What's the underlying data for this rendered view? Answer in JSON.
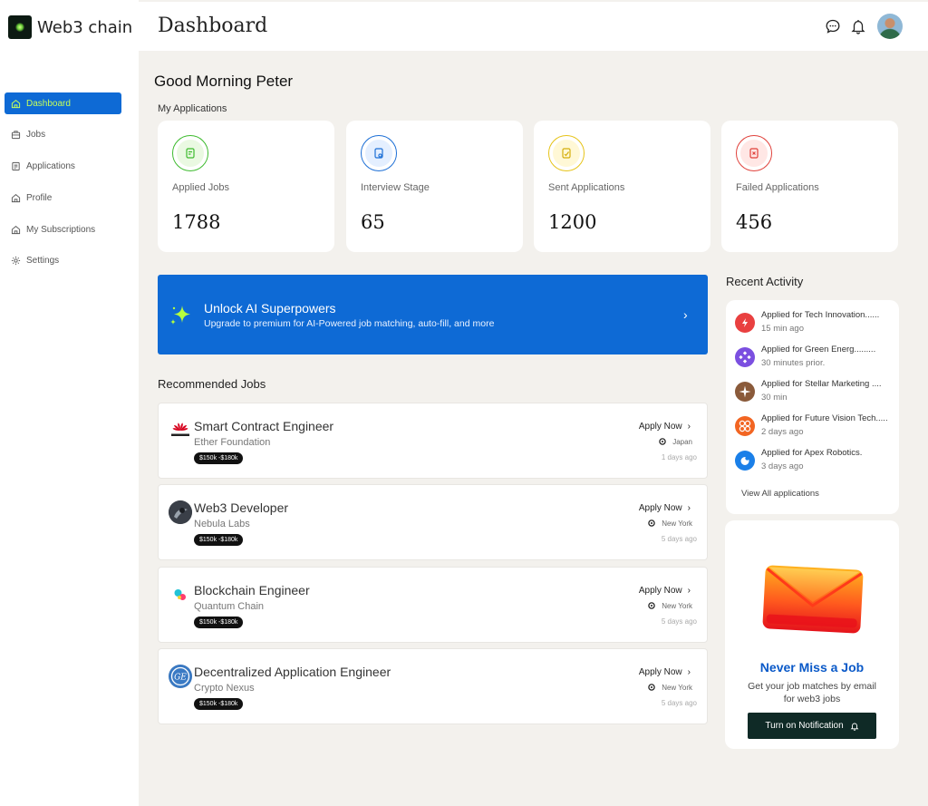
{
  "app": {
    "brand": "Web3 chain"
  },
  "sidebar": {
    "items": [
      {
        "label": "Dashboard",
        "icon": "home-icon",
        "active": true
      },
      {
        "label": "Jobs",
        "icon": "briefcase-icon"
      },
      {
        "label": "Applications",
        "icon": "document-icon"
      },
      {
        "label": "Profile",
        "icon": "home-icon"
      },
      {
        "label": "My Subscriptions",
        "icon": "home-icon"
      },
      {
        "label": "Settings",
        "icon": "gear-icon"
      }
    ]
  },
  "header": {
    "title": "Dashboard"
  },
  "greeting": "Good Morning Peter",
  "my_applications": {
    "label": "My Applications",
    "cards": [
      {
        "label": "Applied Jobs",
        "value": "1788",
        "color": "#3dbb2e"
      },
      {
        "label": "Interview Stage",
        "value": "65",
        "color": "#1c6fd6"
      },
      {
        "label": "Sent Applications",
        "value": "1200",
        "color": "#e6c317"
      },
      {
        "label": "Failed Applications",
        "value": "456",
        "color": "#e0403a"
      }
    ]
  },
  "banner": {
    "title": "Unlock AI Superpowers",
    "subtitle": "Upgrade to premium for AI-Powered job matching, auto-fill, and more"
  },
  "recommended": {
    "label": "Recommended Jobs",
    "apply_label": "Apply Now",
    "jobs": [
      {
        "title": "Smart Contract Engineer",
        "company": "Ether Foundation",
        "salary": "$150k -$180k",
        "location": "Japan",
        "posted": "1 days ago",
        "logo": "huawei-logo"
      },
      {
        "title": "Web3 Developer",
        "company": "Nebula Labs",
        "salary": "$150k -$180k",
        "location": "New York",
        "posted": "5 days ago",
        "logo": "nebula-logo"
      },
      {
        "title": "Blockchain Engineer",
        "company": "Quantum Chain",
        "salary": "$150k -$180k",
        "location": "New York",
        "posted": "5 days ago",
        "logo": "quantum-logo"
      },
      {
        "title": "Decentralized Application Engineer",
        "company": "Crypto Nexus",
        "salary": "$150k -$180k",
        "location": "New York",
        "posted": "5 days ago",
        "logo": "ge-logo"
      }
    ]
  },
  "recent_activity": {
    "label": "Recent Activity",
    "items": [
      {
        "title": "Applied for Tech Innovation......",
        "time": "15 min ago",
        "color": "#e94040"
      },
      {
        "title": "Applied for Green Energ.........",
        "time": "30 minutes prior.",
        "color": "#7b4fe0"
      },
      {
        "title": "Applied for Stellar Marketing ....",
        "time": "30 min",
        "color": "#8a5a3a"
      },
      {
        "title": "Applied for Future Vision Tech.....",
        "time": "2 days ago",
        "color": "#f26522"
      },
      {
        "title": "Applied for Apex Robotics.",
        "time": "3 days ago",
        "color": "#1a7fe8"
      }
    ],
    "view_all": "View All applications"
  },
  "notification": {
    "title": "Never Miss a Job",
    "subtitle": "Get your job matches by email for web3 jobs",
    "button": "Turn on Notification"
  }
}
